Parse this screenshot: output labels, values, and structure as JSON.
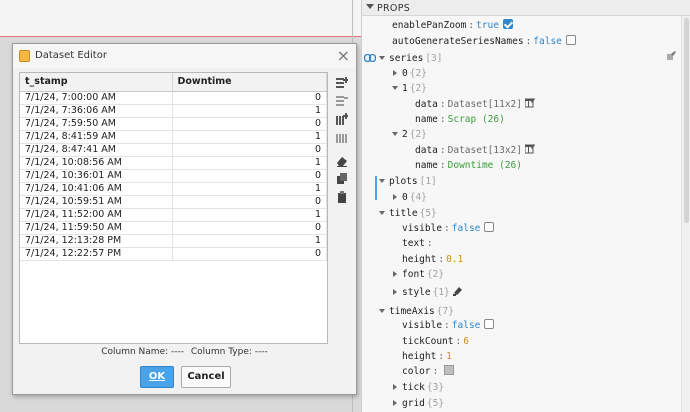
{
  "dialog": {
    "title": "Dataset Editor",
    "close_glyph": "×",
    "columns": [
      "t_stamp",
      "Downtime"
    ],
    "rows": [
      [
        "7/1/24, 7:00:00 AM",
        "0"
      ],
      [
        "7/1/24, 7:36:06 AM",
        "1"
      ],
      [
        "7/1/24, 7:59:50 AM",
        "0"
      ],
      [
        "7/1/24, 8:41:59 AM",
        "1"
      ],
      [
        "7/1/24, 8:47:41 AM",
        "0"
      ],
      [
        "7/1/24, 10:08:56 AM",
        "1"
      ],
      [
        "7/1/24, 10:36:01 AM",
        "0"
      ],
      [
        "7/1/24, 10:41:06 AM",
        "1"
      ],
      [
        "7/1/24, 10:59:51 AM",
        "0"
      ],
      [
        "7/1/24, 11:52:00 AM",
        "1"
      ],
      [
        "7/1/24, 11:59:50 AM",
        "0"
      ],
      [
        "7/1/24, 12:13:28 PM",
        "1"
      ],
      [
        "7/1/24, 12:22:57 PM",
        "0"
      ]
    ],
    "column_name_label": "Column Name: ----",
    "column_type_label": "Column Type: ----",
    "ok_label": "OK",
    "cancel_label": "Cancel",
    "tool_icons": [
      "add-row-icon",
      "remove-row-icon",
      "add-column-icon",
      "remove-column-icon",
      "eraser-icon",
      "copy-icon",
      "paste-icon"
    ]
  },
  "props": {
    "header": "PROPS",
    "enablePanZoom": {
      "key": "enablePanZoom",
      "value": "true"
    },
    "autoGenerateSeriesNames": {
      "key": "autoGenerateSeriesNames",
      "value": "false"
    },
    "series": {
      "key": "series",
      "count": "[3]"
    },
    "series_0": {
      "key": "0",
      "count": "{2}"
    },
    "series_1": {
      "key": "1",
      "count": "{2}"
    },
    "series_1_data": {
      "key": "data",
      "value": "Dataset[11x2]"
    },
    "series_1_name": {
      "key": "name",
      "value": "Scrap (26)"
    },
    "series_2": {
      "key": "2",
      "count": "{2}"
    },
    "series_2_data": {
      "key": "data",
      "value": "Dataset[13x2]"
    },
    "series_2_name": {
      "key": "name",
      "value": "Downtime (26)"
    },
    "plots": {
      "key": "plots",
      "count": "[1]"
    },
    "plots_0": {
      "key": "0",
      "count": "{4}"
    },
    "title": {
      "key": "title",
      "count": "{5}"
    },
    "title_visible": {
      "key": "visible",
      "value": "false"
    },
    "title_text": {
      "key": "text",
      "value": ""
    },
    "title_height": {
      "key": "height",
      "value": "0.1"
    },
    "title_font": {
      "key": "font",
      "count": "{2}"
    },
    "title_style": {
      "key": "style",
      "count": "{1}"
    },
    "timeAxis": {
      "key": "timeAxis",
      "count": "{7}"
    },
    "timeAxis_visible": {
      "key": "visible",
      "value": "false"
    },
    "timeAxis_tickCount": {
      "key": "tickCount",
      "value": "6"
    },
    "timeAxis_height": {
      "key": "height",
      "value": "1"
    },
    "timeAxis_color": {
      "key": "color",
      "value": ""
    },
    "timeAxis_tick": {
      "key": "tick",
      "count": "{3}"
    },
    "timeAxis_grid": {
      "key": "grid",
      "count": "{5}"
    },
    "colon": ":"
  },
  "colors": {
    "accent": "#4aa3e8",
    "bool": "#2f86cb",
    "string": "#3a9c3a",
    "number": "#d88a1a",
    "canvas_red_line": "#e57373"
  }
}
